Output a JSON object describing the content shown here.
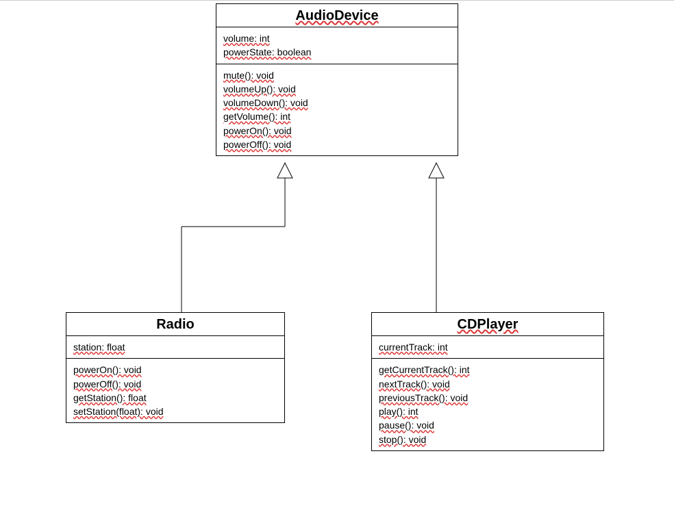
{
  "classes": {
    "audioDevice": {
      "name": "AudioDevice",
      "attrs": {
        "a0": "volume: int",
        "a1": "powerState: boolean"
      },
      "methods": {
        "m0": "mute(): void",
        "m1": "volumeUp(): void",
        "m2": "volumeDown(): void",
        "m3": "getVolume(): int",
        "m4": "powerOn(): void",
        "m5": "powerOff(): void"
      }
    },
    "radio": {
      "name": "Radio",
      "attrs": {
        "a0": "station: float"
      },
      "methods": {
        "m0": "powerOn(): void",
        "m1": "powerOff(): void",
        "m2": "getStation(): float",
        "m3": "setStation(float): void"
      }
    },
    "cdPlayer": {
      "name": "CDPlayer",
      "attrs": {
        "a0": "currentTrack: int"
      },
      "methods": {
        "m0": "getCurrentTrack(): int",
        "m1": "nextTrack(): void",
        "m2": "previousTrack(): void",
        "m3": "play(): int",
        "m4": "pause(): void",
        "m5": "stop(): void"
      }
    }
  },
  "relations": {
    "r0": {
      "from": "radio",
      "to": "audioDevice",
      "type": "generalization"
    },
    "r1": {
      "from": "cdPlayer",
      "to": "audioDevice",
      "type": "generalization"
    }
  }
}
